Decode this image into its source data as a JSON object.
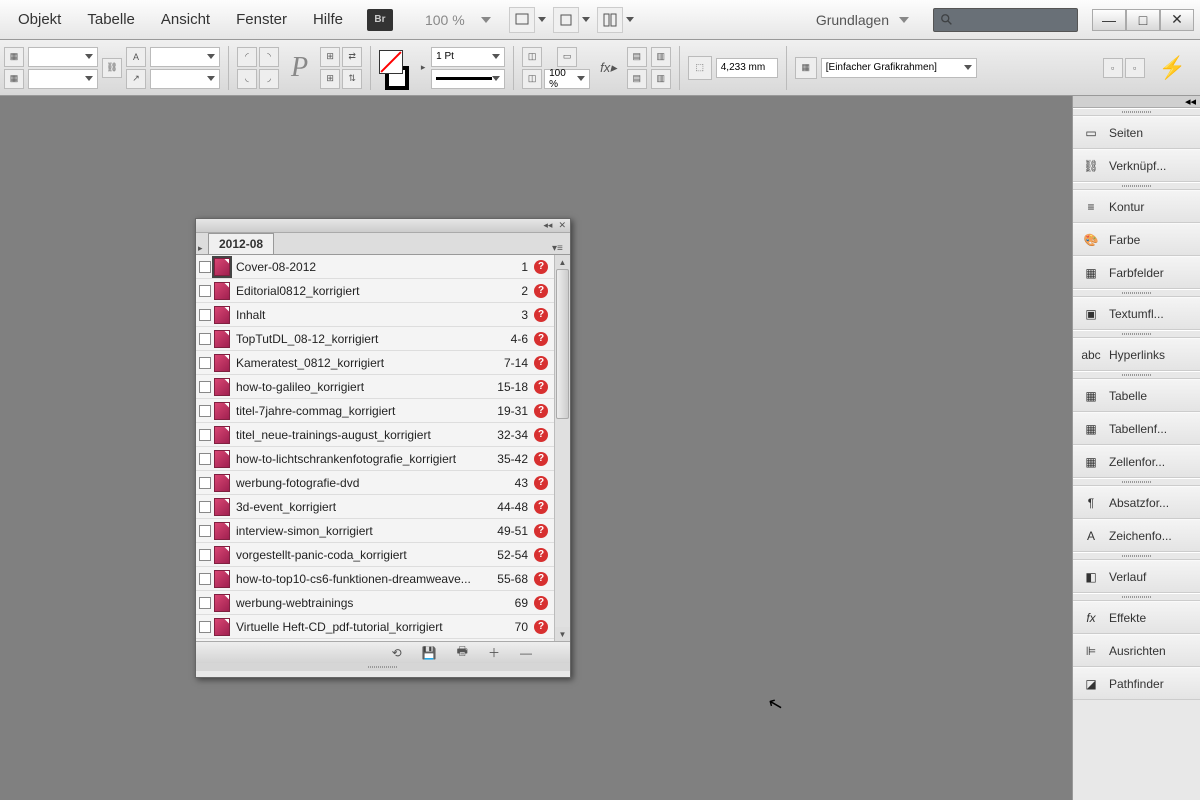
{
  "menu": {
    "objekt": "Objekt",
    "tabelle": "Tabelle",
    "ansicht": "Ansicht",
    "fenster": "Fenster",
    "hilfe": "Hilfe"
  },
  "br": "Br",
  "zoom": "100 %",
  "workspace": "Grundlagen",
  "controlbar": {
    "stroke_weight": "1 Pt",
    "opacity": "100 %",
    "dimension": "4,233 mm",
    "preset": "[Einfacher Grafikrahmen]"
  },
  "panels": {
    "seiten": "Seiten",
    "verkn": "Verknüpf...",
    "kontur": "Kontur",
    "farbe": "Farbe",
    "farbfelder": "Farbfelder",
    "textumfl": "Textumfl...",
    "hyperlinks": "Hyperlinks",
    "tabelle": "Tabelle",
    "tabellenf": "Tabellenf...",
    "zellenfor": "Zellenfor...",
    "absatz": "Absatzfor...",
    "zeichen": "Zeichenfo...",
    "verlauf": "Verlauf",
    "effekte": "Effekte",
    "ausrichten": "Ausrichten",
    "pathfinder": "Pathfinder"
  },
  "book": {
    "tab": "2012-08",
    "items": [
      {
        "name": "Cover-08-2012",
        "pages": "1",
        "sel": true
      },
      {
        "name": "Editorial0812_korrigiert",
        "pages": "2"
      },
      {
        "name": "Inhalt",
        "pages": "3"
      },
      {
        "name": "TopTutDL_08-12_korrigiert",
        "pages": "4-6"
      },
      {
        "name": "Kameratest_0812_korrigiert",
        "pages": "7-14"
      },
      {
        "name": "how-to-galileo_korrigiert",
        "pages": "15-18"
      },
      {
        "name": "titel-7jahre-commag_korrigiert",
        "pages": "19-31"
      },
      {
        "name": "titel_neue-trainings-august_korrigiert",
        "pages": "32-34"
      },
      {
        "name": "how-to-lichtschrankenfotografie_korrigiert",
        "pages": "35-42"
      },
      {
        "name": "werbung-fotografie-dvd",
        "pages": "43"
      },
      {
        "name": "3d-event_korrigiert",
        "pages": "44-48"
      },
      {
        "name": "interview-simon_korrigiert",
        "pages": "49-51"
      },
      {
        "name": "vorgestellt-panic-coda_korrigiert",
        "pages": "52-54"
      },
      {
        "name": "how-to-top10-cs6-funktionen-dreamweave...",
        "pages": "55-68"
      },
      {
        "name": "werbung-webtrainings",
        "pages": "69"
      },
      {
        "name": "Virtuelle Heft-CD_pdf-tutorial_korrigiert",
        "pages": "70"
      }
    ]
  }
}
